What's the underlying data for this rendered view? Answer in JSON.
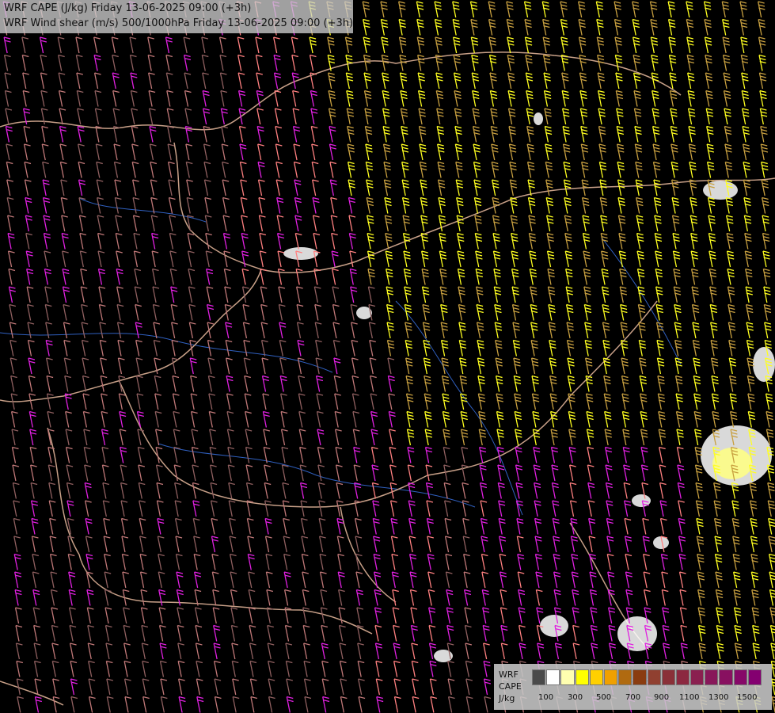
{
  "title": {
    "line1": "WRF CAPE (J/kg) Friday 13-06-2025 09:00 (+3h)",
    "line2": "WRF Wind shear (m/s) 500/1000hPa Friday 13-06-2025 09:00 (+3h)"
  },
  "legend": {
    "label_model": "WRF",
    "label_param": "CAPE",
    "label_unit": "J/kg",
    "ticks": [
      "100",
      "300",
      "500",
      "700",
      "900",
      "1100",
      "1300",
      "1500"
    ],
    "colors": [
      "#4a4a4a",
      "#ffffff",
      "#ffffb0",
      "#ffff00",
      "#ffd000",
      "#f0a000",
      "#b06a10",
      "#8a3c10",
      "#904030",
      "#8a3038",
      "#8c2840",
      "#8a2050",
      "#88185a",
      "#881060",
      "#860868",
      "#840070"
    ]
  },
  "map": {
    "barb_colors": {
      "low": "#c07878",
      "low_dim": "#906060",
      "mid": "#ff8080",
      "magenta": "#e020e0",
      "tan": "#c8a040",
      "yellow": "#ffff20"
    },
    "border_color": "#c8a088",
    "river_color": "#3060c0"
  }
}
